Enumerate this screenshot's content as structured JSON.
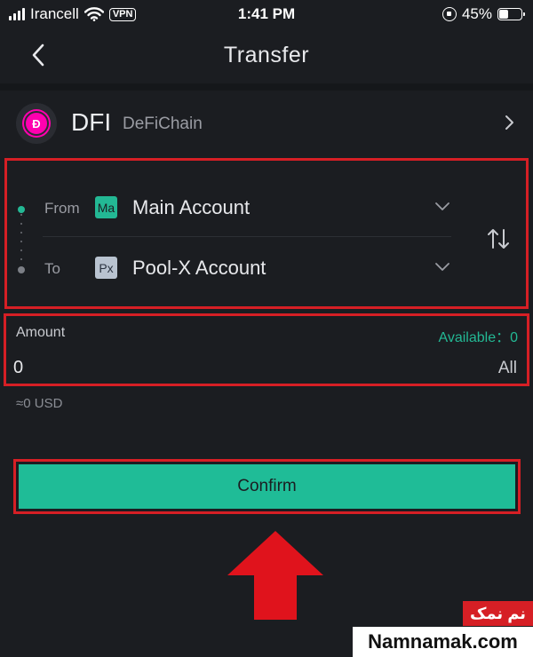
{
  "status_bar": {
    "carrier": "Irancell",
    "vpn": "VPN",
    "time": "1:41 PM",
    "battery_pct_label": "45%",
    "battery_level": 0.45
  },
  "header": {
    "title": "Transfer"
  },
  "coin": {
    "symbol": "DFI",
    "name": "DeFiChain",
    "icon_glyph": "Đ",
    "icon_color": "#ff00af"
  },
  "transfer": {
    "from_label": "From",
    "from_badge": "Ma",
    "from_account": "Main Account",
    "to_label": "To",
    "to_badge": "Px",
    "to_account": "Pool-X Account"
  },
  "amount": {
    "label": "Amount",
    "available": "Available：0",
    "value": "0",
    "all_label": "All",
    "usd_estimate": "≈0 USD"
  },
  "confirm_label": "Confirm",
  "watermark": {
    "fa": "نم نمک",
    "en": "Namnamak.com"
  },
  "colors": {
    "background": "#1b1d21",
    "accent": "#1fbc97",
    "highlight": "#d61f25"
  }
}
